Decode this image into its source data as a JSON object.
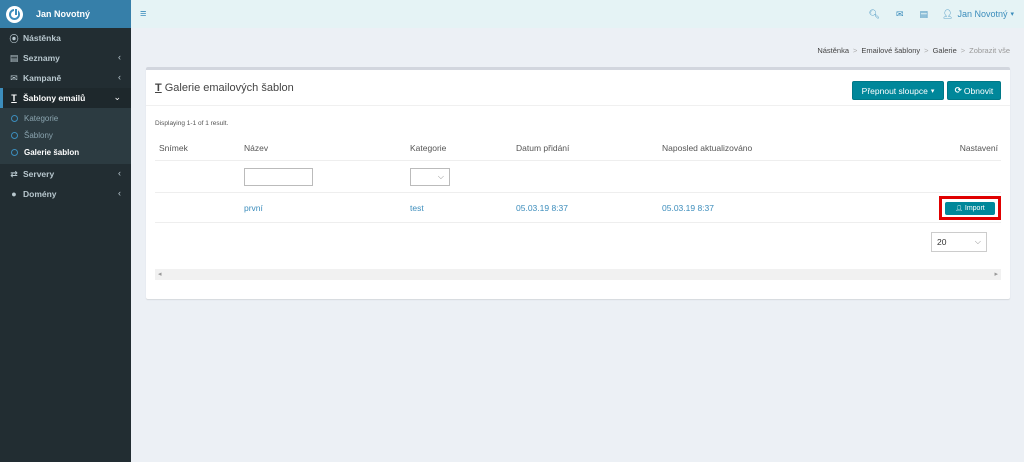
{
  "brand": {
    "user_name": "Jan Novotný"
  },
  "sidebar": {
    "items": [
      {
        "label": "Nástěnka",
        "icon": "dashboard-icon"
      },
      {
        "label": "Seznamy",
        "icon": "list-icon",
        "chevron": "‹"
      },
      {
        "label": "Kampaně",
        "icon": "envelope-icon",
        "chevron": "‹"
      },
      {
        "label": "Šablony emailů",
        "icon": "text-icon",
        "chevron": "⌄"
      },
      {
        "label": "Servery",
        "icon": "exchange-icon",
        "chevron": "‹"
      },
      {
        "label": "Domény",
        "icon": "globe-icon",
        "chevron": "‹"
      }
    ],
    "subitems": [
      {
        "label": "Kategorie"
      },
      {
        "label": "Šablony"
      },
      {
        "label": "Galerie šablon"
      }
    ]
  },
  "topbar": {
    "user_label": "Jan Novotný"
  },
  "breadcrumb": {
    "items": [
      "Nástěnka",
      "Emailové šablony",
      "Galerie",
      "Zobrazit vše"
    ],
    "separator": ">"
  },
  "box": {
    "title": "Galerie emailových šablon",
    "columns_button": "Přepnout sloupce",
    "refresh_button": "Obnovit",
    "summary": "Displaying 1-1 of 1 result."
  },
  "table": {
    "headers": [
      "Snímek",
      "Název",
      "Kategorie",
      "Datum přidání",
      "Naposled aktualizováno",
      "Nastavení"
    ],
    "rows": [
      {
        "snapshot": "",
        "name": "první",
        "category": "test",
        "added": "05.03.19 8:37",
        "updated": "05.03.19 8:37",
        "action": "Import"
      }
    ]
  },
  "pager": {
    "page_size": "20"
  },
  "colors": {
    "accent": "#00879a",
    "sidebar_bg": "#222d32",
    "highlight": "#e00000",
    "brand": "#367fa9"
  }
}
